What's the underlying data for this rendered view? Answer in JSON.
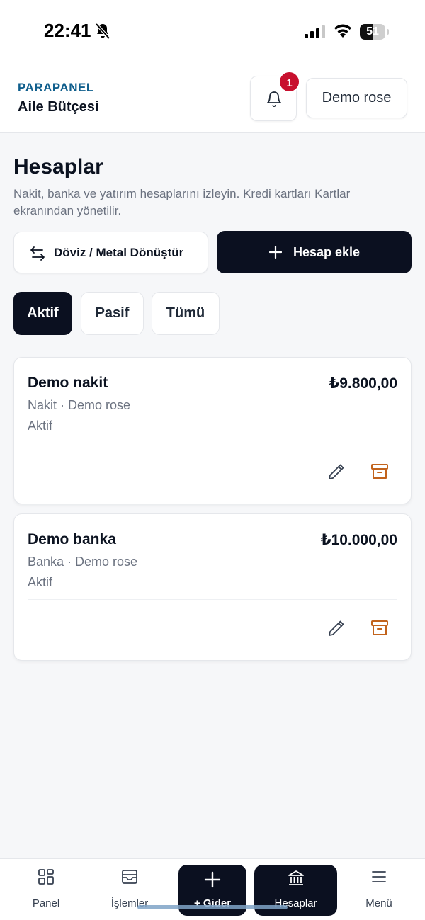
{
  "status_bar": {
    "time": "22:41",
    "battery": "51",
    "battery_level": 0.51
  },
  "header": {
    "brand": "PARAPANEL",
    "subtitle": "Aile Bütçesi",
    "notification_count": "1",
    "user_label": "Demo rose"
  },
  "page": {
    "title": "Hesaplar",
    "description": "Nakit, banka ve yatırım hesaplarını izleyin. Kredi kartları Kartlar ekranından yönetilir."
  },
  "actions": {
    "convert_label": "Döviz / Metal Dönüştür",
    "add_label": "Hesap ekle"
  },
  "tabs": [
    {
      "label": "Aktif",
      "active": true
    },
    {
      "label": "Pasif",
      "active": false
    },
    {
      "label": "Tümü",
      "active": false
    }
  ],
  "accounts": [
    {
      "name": "Demo nakit",
      "amount": "₺9.800,00",
      "meta": "Nakit · Demo rose",
      "status": "Aktif"
    },
    {
      "name": "Demo banka",
      "amount": "₺10.000,00",
      "meta": "Banka · Demo rose",
      "status": "Aktif"
    }
  ],
  "bottom_nav": [
    {
      "label": "Panel",
      "icon": "grid-icon"
    },
    {
      "label": "İşlemler",
      "icon": "inbox-icon"
    },
    {
      "label": "+ Gider",
      "icon": "plus-icon"
    },
    {
      "label": "Hesaplar",
      "icon": "bank-icon"
    },
    {
      "label": "Menü",
      "icon": "menu-icon"
    }
  ],
  "colors": {
    "brand": "#0f5e8c",
    "primary_dark": "#0b1020",
    "badge": "#c8102e",
    "archive_icon": "#c2631c"
  }
}
